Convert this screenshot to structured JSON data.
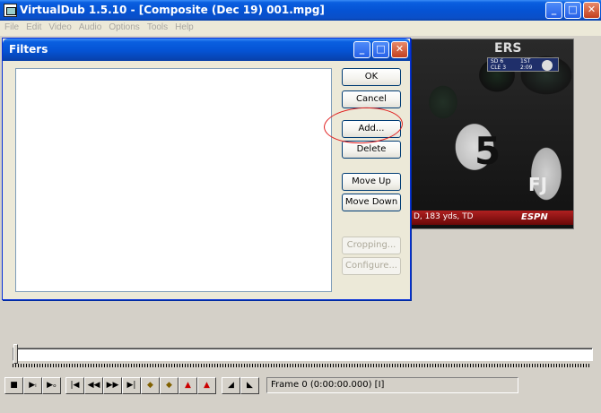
{
  "window": {
    "title": "VirtualDub 1.5.10 - [Composite (Dec 19) 001.mpg]",
    "controls": {
      "minimize": "_",
      "maximize": "□",
      "close": "✕"
    }
  },
  "menu": {
    "items": [
      "File",
      "Edit",
      "Video",
      "Audio",
      "Options",
      "Tools",
      "Help"
    ]
  },
  "filters_dialog": {
    "title": "Filters",
    "controls": {
      "minimize": "_",
      "maximize": "□",
      "close": "✕"
    },
    "buttons": {
      "ok": "OK",
      "cancel": "Cancel",
      "add": "Add...",
      "delete": "Delete",
      "move_up": "Move Up",
      "move_down": "Move Down",
      "cropping": "Cropping...",
      "configure": "Configure..."
    },
    "highlight_color": "#e02020"
  },
  "video_preview": {
    "jersey_text": "ERS",
    "jersey_numbers": [
      "5",
      "FJ"
    ],
    "scorebug": {
      "rows": [
        "SD 6",
        "CLE 3"
      ],
      "clock": [
        "1ST",
        "2:09"
      ]
    },
    "ticker_text": "D, 183 yds, TD",
    "network_logo": "ESPN"
  },
  "transport": {
    "icons": [
      "stop-icon",
      "play-input-icon",
      "play-output-icon",
      "go-start-icon",
      "prev-frame-icon",
      "next-frame-icon",
      "go-end-icon",
      "prev-keyframe-icon",
      "next-keyframe-icon",
      "prev-scene-icon",
      "next-scene-icon",
      "mark-in-icon",
      "mark-out-icon"
    ],
    "frame_readout": "Frame 0 (0:00:00.000) [I]"
  }
}
